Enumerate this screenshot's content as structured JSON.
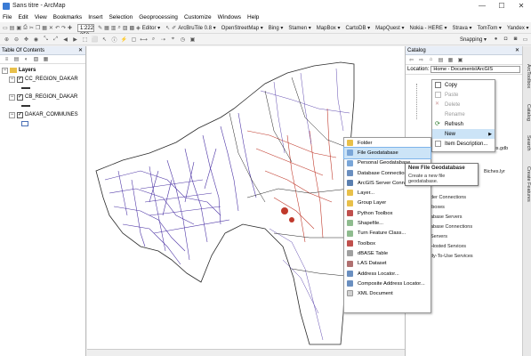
{
  "window": {
    "title": "Sans titre - ArcMap",
    "minimize": "—",
    "maximize": "☐",
    "close": "✕"
  },
  "menu": [
    "File",
    "Edit",
    "View",
    "Bookmarks",
    "Insert",
    "Selection",
    "Geoprocessing",
    "Customize",
    "Windows",
    "Help"
  ],
  "toolbar": {
    "scale": "1:222 350",
    "editor_label": "Editor ▾",
    "plugins": [
      "ArcBruTile 0.8 ▾",
      "OpenStreetMap ▾",
      "Bing ▾",
      "Stamen ▾",
      "MapBox ▾",
      "CartoDB ▾",
      "MapQuest ▾",
      "Nokia - HERE ▾",
      "Strava ▾",
      "TomTom ▾",
      "Yandex ▾"
    ],
    "snapping_label": "Snapping ▾"
  },
  "toc": {
    "title": "Table Of Contents",
    "layers_root": "Layers",
    "layers": [
      {
        "name": "CC_REGION_DAKAR",
        "symbol": "line"
      },
      {
        "name": "CB_REGION_DAKAR",
        "symbol": "line"
      },
      {
        "name": "DAKAR_COMMUNES",
        "symbol": "polygon"
      }
    ]
  },
  "catalog": {
    "title": "Catalog",
    "location_label": "Location:",
    "location_value": "Home - Documents\\ArcGIS",
    "items_visible": [
      "Biches.gdb",
      "Biches.lyr",
      "der Connections",
      "lboxes",
      "abase Servers",
      "abase Connections",
      "Servers",
      "Hosted Services",
      "dy-To-Use Services"
    ]
  },
  "context_menu_primary": {
    "items": [
      {
        "label": "Copy",
        "disabled": false,
        "icon": "copy-icon"
      },
      {
        "label": "Paste",
        "disabled": true,
        "icon": "paste-icon"
      },
      {
        "label": "Delete",
        "disabled": true,
        "icon": "delete-icon"
      },
      {
        "label": "Rename",
        "disabled": true,
        "icon": "rename-icon"
      },
      {
        "label": "Refresh",
        "disabled": false,
        "icon": "refresh-icon"
      },
      {
        "label": "New",
        "disabled": false,
        "icon": "",
        "submenu": true,
        "highlighted": true
      },
      {
        "label": "Item Description...",
        "disabled": false,
        "icon": "item-description-icon"
      }
    ]
  },
  "context_menu_new": {
    "items": [
      {
        "label": "Folder",
        "icon": "folder-icon",
        "color": "#e8c04a"
      },
      {
        "label": "File Geodatabase",
        "icon": "file-geodatabase-icon",
        "color": "#7aa6d8",
        "highlighted": true
      },
      {
        "label": "Personal Geodatabase",
        "icon": "personal-geodatabase-icon",
        "color": "#7aa6d8"
      },
      {
        "label": "Database Connection...",
        "icon": "database-connection-icon",
        "color": "#6a8fc0"
      },
      {
        "label": "ArcGIS Server Connection...",
        "icon": "server-connection-icon",
        "color": "#5a7fb0"
      },
      {
        "label": "Layer...",
        "icon": "layer-icon",
        "color": "#e8c04a"
      },
      {
        "label": "Group Layer",
        "icon": "group-layer-icon",
        "color": "#e8c04a"
      },
      {
        "label": "Python Toolbox",
        "icon": "python-toolbox-icon",
        "color": "#c0504d"
      },
      {
        "label": "Shapefile...",
        "icon": "shapefile-icon",
        "color": "#8fbc8f"
      },
      {
        "label": "Turn Feature Class...",
        "icon": "feature-class-icon",
        "color": "#8fbc8f"
      },
      {
        "label": "Toolbox",
        "icon": "toolbox-icon",
        "color": "#c0504d"
      },
      {
        "label": "dBASE Table",
        "icon": "dbase-table-icon",
        "color": "#a0a0a0"
      },
      {
        "label": "LAS Dataset",
        "icon": "las-dataset-icon",
        "color": "#b07070"
      },
      {
        "label": "Address Locator...",
        "icon": "address-locator-icon",
        "color": "#6a8fc0"
      },
      {
        "label": "Composite Address Locator...",
        "icon": "composite-locator-icon",
        "color": "#6a8fc0"
      },
      {
        "label": "XML Document",
        "icon": "xml-document-icon",
        "color": "#d0d0d0"
      }
    ]
  },
  "tooltip": {
    "title": "New File Geodatabase",
    "description": "Create a new file geodatabase."
  },
  "side_tabs": [
    "ArcToolbox",
    "Catalog",
    "Search",
    "Create Features"
  ]
}
